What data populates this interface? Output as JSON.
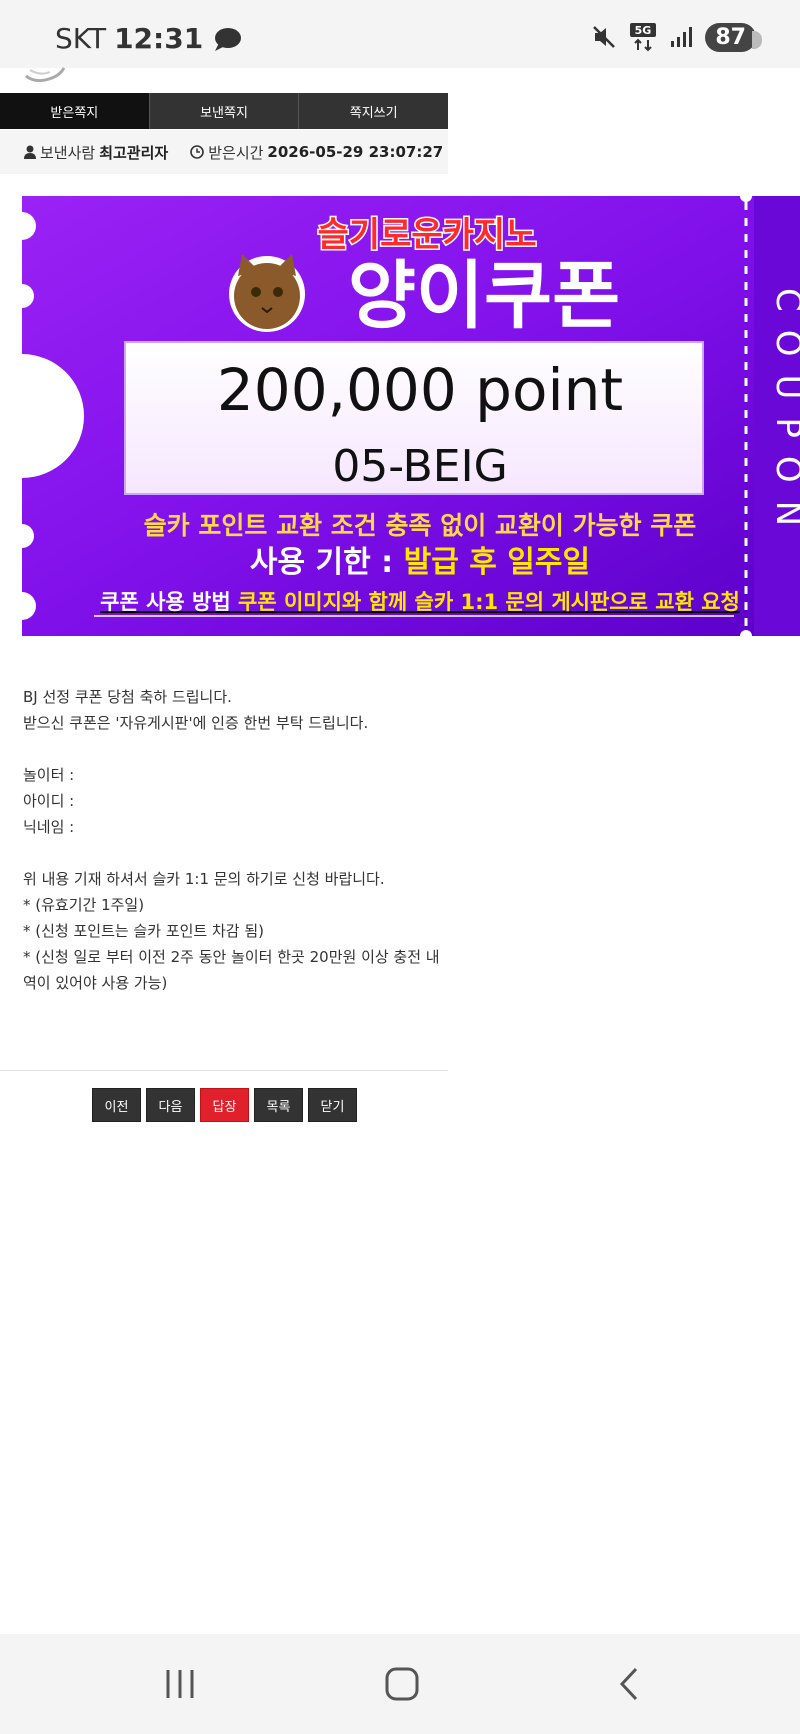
{
  "status_bar": {
    "carrier": "SKT",
    "time": "12:31",
    "network": "5G",
    "battery": "87"
  },
  "tabs": [
    {
      "label": "받은쪽지",
      "active": true
    },
    {
      "label": "보낸쪽지",
      "active": false
    },
    {
      "label": "쪽지쓰기",
      "active": false
    }
  ],
  "info": {
    "sender_label": "보낸사람",
    "sender_name": "최고관리자",
    "time_label": "받은시간",
    "time_value": "2026-05-29 23:07:27"
  },
  "coupon": {
    "brand": "슬기로운카지노",
    "title": "양이쿠폰",
    "amount": "200,000 point",
    "code": "05-BEIG",
    "desc_line1": "슬카 포인트 교환 조건 충족 없이 교환이 가능한 쿠폰",
    "expiry_label": "사용 기한 : ",
    "expiry_value": "발급 후 일주일",
    "usage_label": "쿠폰 사용 방법",
    "usage_value": "쿠폰 이미지와 함께 슬카 1:1 문의 게시판으로 교환 요청",
    "side_text": "COUPON",
    "colors": {
      "purple": "#8a10f0",
      "deep_purple": "#5a00c8",
      "yellow": "#ffe600",
      "red": "#e0202a"
    }
  },
  "message": {
    "lines": [
      "BJ 선정 쿠폰 당첨 축하 드립니다.",
      "받으신 쿠폰은 '자유게시판'에 인증 한번 부탁 드립니다.",
      "",
      "놀이터 :",
      "아이디 :",
      "닉네임 :",
      "",
      "위 내용 기재 하셔서 슬카 1:1 문의 하기로 신청 바랍니다.",
      "* (유효기간 1주일)",
      "* (신청 포인트는 슬카 포인트 차감 됨)",
      "* (신청 일로 부터 이전 2주 동안 놀이터 한곳 20만원 이상 충전 내역이 있어야 사용 가능)"
    ]
  },
  "buttons": {
    "prev": "이전",
    "next": "다음",
    "reply": "답장",
    "list": "목록",
    "close": "닫기"
  }
}
